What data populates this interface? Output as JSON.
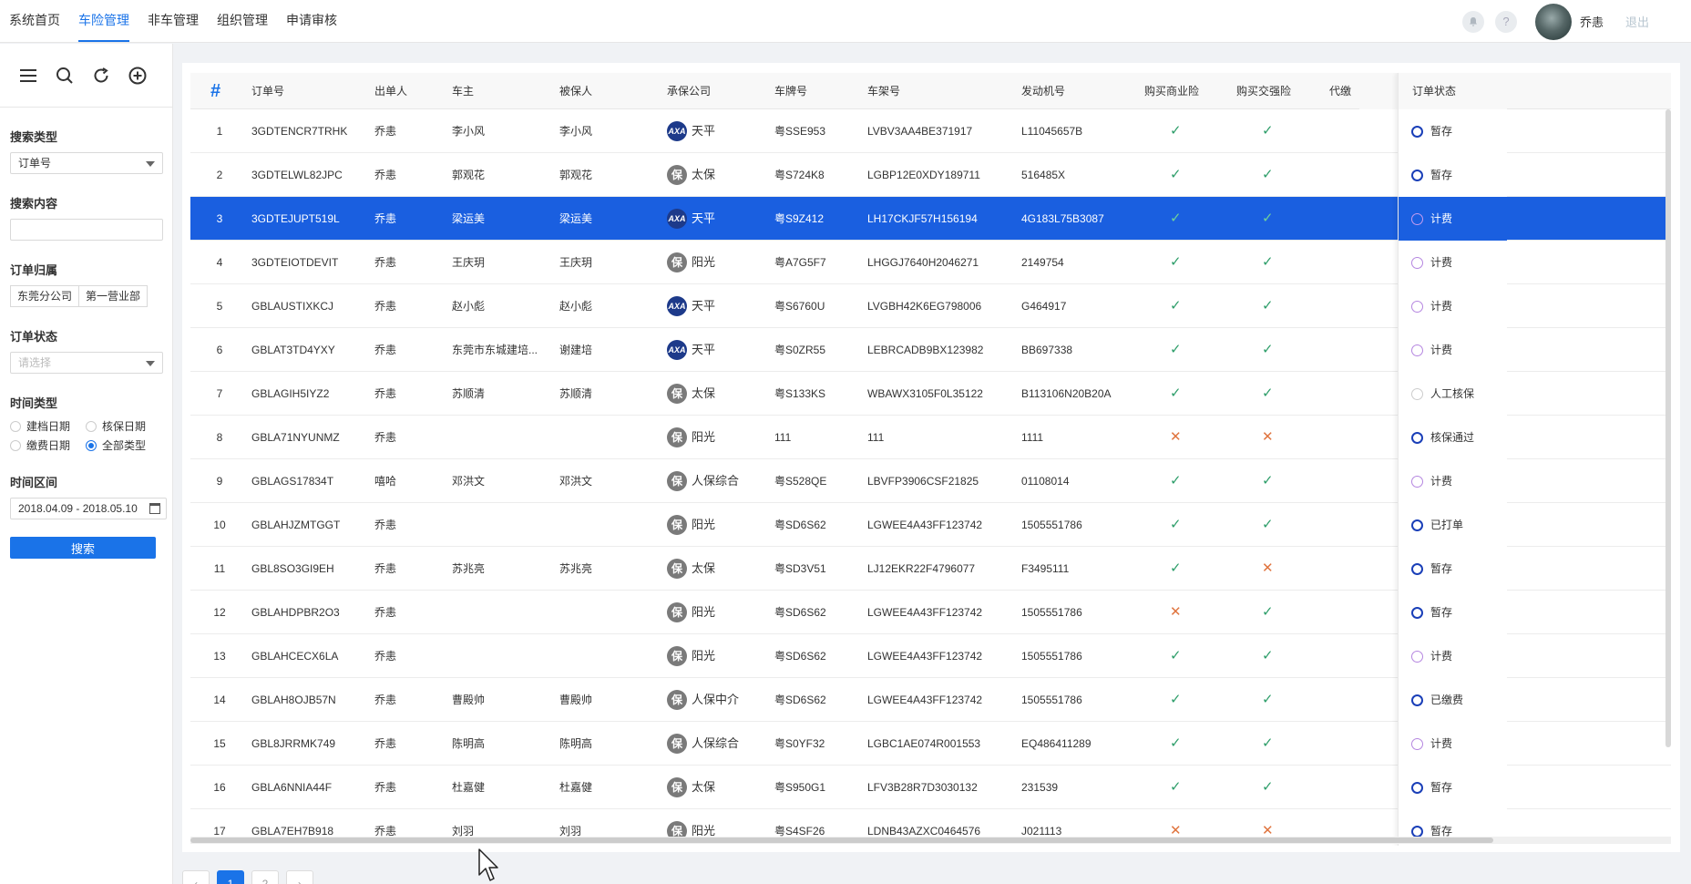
{
  "nav": {
    "items": [
      "系统首页",
      "车险管理",
      "非车管理",
      "组织管理",
      "申请审核"
    ],
    "active_index": 1
  },
  "header": {
    "bell_icon": "bell-icon",
    "help_label": "?",
    "username": "乔恚",
    "logout_label": "退出"
  },
  "sidebar": {
    "search_type_label": "搜索类型",
    "search_type_value": "订单号",
    "search_content_label": "搜索内容",
    "search_content_value": "",
    "belong_label": "订单归属",
    "belong_values": [
      "东莞分公司",
      "第一营业部"
    ],
    "status_label": "订单状态",
    "status_placeholder": "请选择",
    "time_type_label": "时间类型",
    "time_type_options": [
      "建档日期",
      "核保日期",
      "缴费日期",
      "全部类型"
    ],
    "time_type_selected": 3,
    "range_label": "时间区间",
    "range_value": "2018.04.09 - 2018.05.10",
    "search_button": "搜索"
  },
  "table": {
    "headers": {
      "index": "#",
      "order_no": "订单号",
      "issuer": "出单人",
      "owner": "车主",
      "insured": "被保人",
      "company": "承保公司",
      "plate": "车牌号",
      "vin": "车架号",
      "engine": "发动机号",
      "commercial": "购买商业险",
      "compulsory": "购买交强险",
      "agent": "代缴",
      "status": "订单状态"
    },
    "selected_row": 2,
    "rows": [
      {
        "idx": "1",
        "order": "3GDTENCR7TRHK",
        "issuer": "乔恚",
        "owner": "李小风",
        "insured": "李小风",
        "logo": "axa",
        "company": "天平",
        "plate": "粤SSE953",
        "vin": "LVBV3AA4BE371917",
        "engine": "L11045657B",
        "com": true,
        "cmp": true,
        "status": "暂存",
        "ring": "blue"
      },
      {
        "idx": "2",
        "order": "3GDTELWL82JPC",
        "issuer": "乔恚",
        "owner": "郭观花",
        "insured": "郭观花",
        "logo": "bao",
        "company": "太保",
        "plate": "粤S724K8",
        "vin": "LGBP12E0XDY189711",
        "engine": "516485X",
        "com": true,
        "cmp": true,
        "status": "暂存",
        "ring": "blue"
      },
      {
        "idx": "3",
        "order": "3GDTEJUPT519L",
        "issuer": "乔恚",
        "owner": "梁运美",
        "insured": "梁运美",
        "logo": "axa",
        "company": "天平",
        "plate": "粤S9Z412",
        "vin": "LH17CKJF57H156194",
        "engine": "4G183L75B3087",
        "com": true,
        "cmp": true,
        "status": "计费",
        "ring": "purple"
      },
      {
        "idx": "4",
        "order": "3GDTEIOTDEVIT",
        "issuer": "乔恚",
        "owner": "王庆玥",
        "insured": "王庆玥",
        "logo": "bao",
        "company": "阳光",
        "plate": "粤A7G5F7",
        "vin": "LHGGJ7640H2046271",
        "engine": "2149754",
        "com": true,
        "cmp": true,
        "status": "计费",
        "ring": "purple"
      },
      {
        "idx": "5",
        "order": "GBLAUSTIXKCJ",
        "issuer": "乔恚",
        "owner": "赵小彪",
        "insured": "赵小彪",
        "logo": "axa",
        "company": "天平",
        "plate": "粤S6760U",
        "vin": "LVGBH42K6EG798006",
        "engine": "G464917",
        "com": true,
        "cmp": true,
        "status": "计费",
        "ring": "purple"
      },
      {
        "idx": "6",
        "order": "GBLAT3TD4YXY",
        "issuer": "乔恚",
        "owner": "东莞市东城建培...",
        "insured": "谢建培",
        "logo": "axa",
        "company": "天平",
        "plate": "粤S0ZR55",
        "vin": "LEBRCADB9BX123982",
        "engine": "BB697338",
        "com": true,
        "cmp": true,
        "status": "计费",
        "ring": "purple"
      },
      {
        "idx": "7",
        "order": "GBLAGIH5IYZ2",
        "issuer": "乔恚",
        "owner": "苏顺清",
        "insured": "苏顺清",
        "logo": "bao",
        "company": "太保",
        "plate": "粤S133KS",
        "vin": "WBAWX3105F0L35122",
        "engine": "B113106N20B20A",
        "com": true,
        "cmp": true,
        "status": "人工核保",
        "ring": "grey"
      },
      {
        "idx": "8",
        "order": "GBLA71NYUNMZ",
        "issuer": "乔恚",
        "owner": "",
        "insured": "",
        "logo": "bao",
        "company": "阳光",
        "plate": "111",
        "vin": "111",
        "engine": "1111",
        "com": false,
        "cmp": false,
        "status": "核保通过",
        "ring": "blue"
      },
      {
        "idx": "9",
        "order": "GBLAGS17834T",
        "issuer": "嘻哈",
        "owner": "邓洪文",
        "insured": "邓洪文",
        "logo": "bao",
        "company": "人保综合",
        "plate": "粤S528QE",
        "vin": "LBVFP3906CSF21825",
        "engine": "01108014",
        "com": true,
        "cmp": true,
        "status": "计费",
        "ring": "purple"
      },
      {
        "idx": "10",
        "order": "GBLAHJZMTGGT",
        "issuer": "乔恚",
        "owner": "",
        "insured": "",
        "logo": "bao",
        "company": "阳光",
        "plate": "粤SD6S62",
        "vin": "LGWEE4A43FF123742",
        "engine": "1505551786",
        "com": true,
        "cmp": true,
        "status": "已打单",
        "ring": "blue"
      },
      {
        "idx": "11",
        "order": "GBL8SO3GI9EH",
        "issuer": "乔恚",
        "owner": "苏兆亮",
        "insured": "苏兆亮",
        "logo": "bao",
        "company": "太保",
        "plate": "粤SD3V51",
        "vin": "LJ12EKR22F4796077",
        "engine": "F3495111",
        "com": true,
        "cmp": false,
        "status": "暂存",
        "ring": "blue"
      },
      {
        "idx": "12",
        "order": "GBLAHDPBR2O3",
        "issuer": "乔恚",
        "owner": "",
        "insured": "",
        "logo": "bao",
        "company": "阳光",
        "plate": "粤SD6S62",
        "vin": "LGWEE4A43FF123742",
        "engine": "1505551786",
        "com": false,
        "cmp": true,
        "status": "暂存",
        "ring": "blue"
      },
      {
        "idx": "13",
        "order": "GBLAHCECX6LA",
        "issuer": "乔恚",
        "owner": "",
        "insured": "",
        "logo": "bao",
        "company": "阳光",
        "plate": "粤SD6S62",
        "vin": "LGWEE4A43FF123742",
        "engine": "1505551786",
        "com": true,
        "cmp": true,
        "status": "计费",
        "ring": "purple"
      },
      {
        "idx": "14",
        "order": "GBLAH8OJB57N",
        "issuer": "乔恚",
        "owner": "曹殿帅",
        "insured": "曹殿帅",
        "logo": "bao",
        "company": "人保中介",
        "plate": "粤SD6S62",
        "vin": "LGWEE4A43FF123742",
        "engine": "1505551786",
        "com": true,
        "cmp": true,
        "status": "已缴费",
        "ring": "blue"
      },
      {
        "idx": "15",
        "order": "GBL8JRRMK749",
        "issuer": "乔恚",
        "owner": "陈明高",
        "insured": "陈明高",
        "logo": "bao",
        "company": "人保综合",
        "plate": "粤S0YF32",
        "vin": "LGBC1AE074R001553",
        "engine": "EQ486411289",
        "com": true,
        "cmp": true,
        "status": "计费",
        "ring": "purple"
      },
      {
        "idx": "16",
        "order": "GBLA6NNIA44F",
        "issuer": "乔恚",
        "owner": "杜嘉健",
        "insured": "杜嘉健",
        "logo": "bao",
        "company": "太保",
        "plate": "粤S950G1",
        "vin": "LFV3B28R7D3030132",
        "engine": "231539",
        "com": true,
        "cmp": true,
        "status": "暂存",
        "ring": "blue"
      },
      {
        "idx": "17",
        "order": "GBLA7EH7B918",
        "issuer": "乔恚",
        "owner": "刘羽",
        "insured": "刘羽",
        "logo": "bao",
        "company": "阳光",
        "plate": "粤S4SF26",
        "vin": "LDNB43AZXC0464576",
        "engine": "J021113",
        "com": false,
        "cmp": false,
        "status": "暂存",
        "ring": "blue"
      }
    ],
    "logos": {
      "axa": "AXA",
      "bao": "保"
    },
    "marks": {
      "check": "✓",
      "cross": "✕"
    }
  },
  "pagination": {
    "pages": [
      "‹",
      "1",
      "2",
      "›"
    ],
    "active": 1
  }
}
